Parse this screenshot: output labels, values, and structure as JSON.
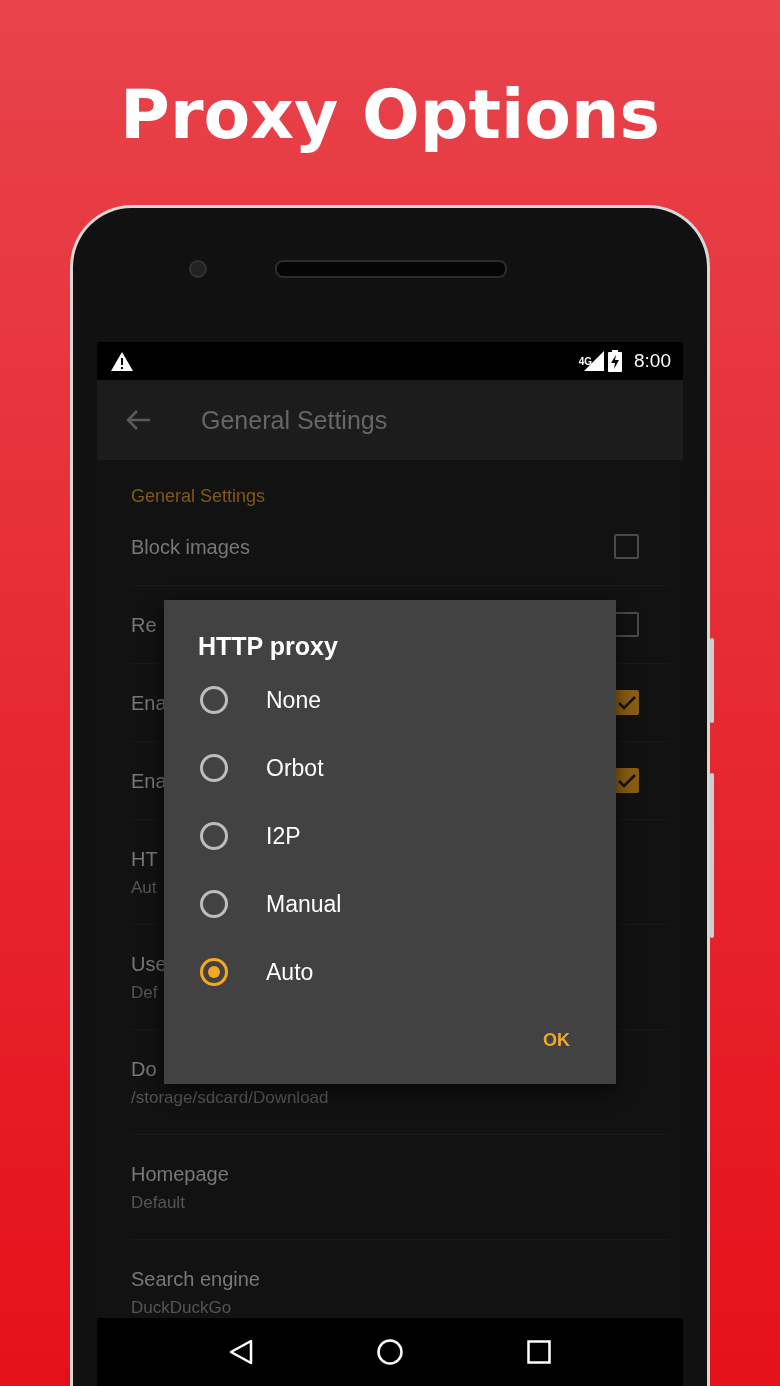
{
  "promo_title": "Proxy Options",
  "status_bar": {
    "network": "4G",
    "time": "8:00"
  },
  "toolbar": {
    "title": "General Settings"
  },
  "settings": {
    "section": "General Settings",
    "rows": [
      {
        "kind": "checkbox",
        "title": "Block images",
        "checked": false
      },
      {
        "kind": "checkbox",
        "title": "Re",
        "checked": false
      },
      {
        "kind": "checkbox",
        "title": "Ena",
        "checked": true
      },
      {
        "kind": "checkbox",
        "title": "Ena",
        "checked": true
      },
      {
        "kind": "value",
        "title": "HT",
        "value": "Aut"
      },
      {
        "kind": "value",
        "title": "Use",
        "value": "Def"
      },
      {
        "kind": "value",
        "title": "Do",
        "value": "/storage/sdcard/Download"
      },
      {
        "kind": "value",
        "title": "Homepage",
        "value": "Default"
      },
      {
        "kind": "value",
        "title": "Search engine",
        "value": "DuckDuckGo"
      }
    ]
  },
  "dialog": {
    "title": "HTTP proxy",
    "options": [
      {
        "label": "None",
        "selected": false
      },
      {
        "label": "Orbot",
        "selected": false
      },
      {
        "label": "I2P",
        "selected": false
      },
      {
        "label": "Manual",
        "selected": false
      },
      {
        "label": "Auto",
        "selected": true
      }
    ],
    "button": "OK"
  }
}
